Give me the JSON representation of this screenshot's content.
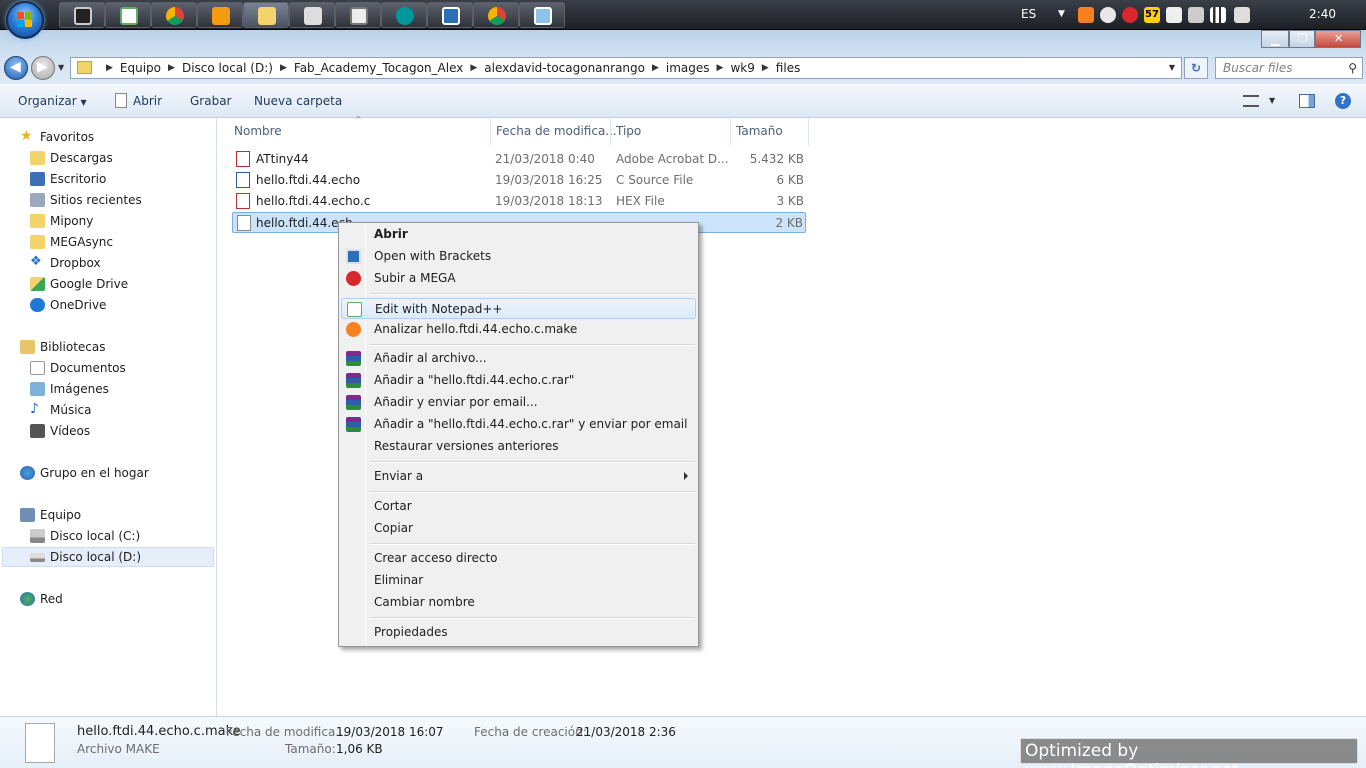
{
  "taskbar": {
    "language": "ES",
    "clock": "2:40",
    "badge": "57",
    "pinned_icons": [
      "lamp-app-icon",
      "notepad-plus-plus-icon",
      "chrome-icon",
      "media-player-icon",
      "file-explorer-icon",
      "inkscape-icon",
      "calculator-icon",
      "arduino-icon",
      "brackets-icon",
      "chrome-icon",
      "image-viewer-icon"
    ]
  },
  "address": {
    "crumbs": [
      "Equipo",
      "Disco local (D:)",
      "Fab_Academy_Tocagon_Alex",
      "alexdavid-tocagonanrango",
      "images",
      "wk9",
      "files"
    ],
    "search_placeholder": "Buscar files"
  },
  "commandbar": {
    "organize": "Organizar",
    "open": "Abrir",
    "burn": "Grabar",
    "new_folder": "Nueva carpeta"
  },
  "nav": {
    "favorites": "Favoritos",
    "fav_items": [
      "Descargas",
      "Escritorio",
      "Sitios recientes",
      "Mipony",
      "MEGAsync",
      "Dropbox",
      "Google Drive",
      "OneDrive"
    ],
    "libraries": "Bibliotecas",
    "lib_items": [
      "Documentos",
      "Imágenes",
      "Música",
      "Vídeos"
    ],
    "homegroup": "Grupo en el hogar",
    "computer": "Equipo",
    "comp_items": [
      "Disco local (C:)",
      "Disco local (D:)"
    ],
    "network": "Red"
  },
  "columns": {
    "name": "Nombre",
    "date": "Fecha de modifica...",
    "type": "Tipo",
    "size": "Tamaño"
  },
  "files": [
    {
      "name": "ATtiny44",
      "date": "21/03/2018 0:40",
      "type": "Adobe Acrobat D...",
      "size": "5.432 KB",
      "icon": "pdf-file-icon"
    },
    {
      "name": "hello.ftdi.44.echo",
      "date": "19/03/2018 16:25",
      "type": "C Source File",
      "size": "6 KB",
      "icon": "c-source-file-icon"
    },
    {
      "name": "hello.ftdi.44.echo.c",
      "date": "19/03/2018 18:13",
      "type": "HEX File",
      "size": "3 KB",
      "icon": "hex-file-icon"
    },
    {
      "name": "hello.ftdi.44.ech",
      "date": "",
      "type": "",
      "size": "2 KB",
      "icon": "generic-file-icon"
    }
  ],
  "context_menu": {
    "open": "Abrir",
    "brackets": "Open with Brackets",
    "mega": "Subir a MEGA",
    "notepad": "Edit with Notepad++",
    "avast": "Analizar hello.ftdi.44.echo.c.make",
    "add_archive": "Añadir al archivo...",
    "add_rar": "Añadir a \"hello.ftdi.44.echo.c.rar\"",
    "add_email": "Añadir y enviar por email...",
    "add_rar_email": "Añadir a \"hello.ftdi.44.echo.c.rar\" y enviar por email",
    "restore": "Restaurar versiones anteriores",
    "send_to": "Enviar a",
    "cut": "Cortar",
    "copy": "Copiar",
    "shortcut": "Crear acceso directo",
    "delete": "Eliminar",
    "rename": "Cambiar nombre",
    "properties": "Propiedades"
  },
  "details": {
    "filename": "hello.ftdi.44.echo.c.make",
    "filetype": "Archivo MAKE",
    "modified_label": "Fecha de modifica...",
    "modified_value": "19/03/2018 16:07",
    "size_label": "Tamaño:",
    "size_value": "1,06 KB",
    "created_label": "Fecha de creación:",
    "created_value": "21/03/2018 2:36"
  },
  "watermark": "Optimized by www.ImageOptimizer.net"
}
